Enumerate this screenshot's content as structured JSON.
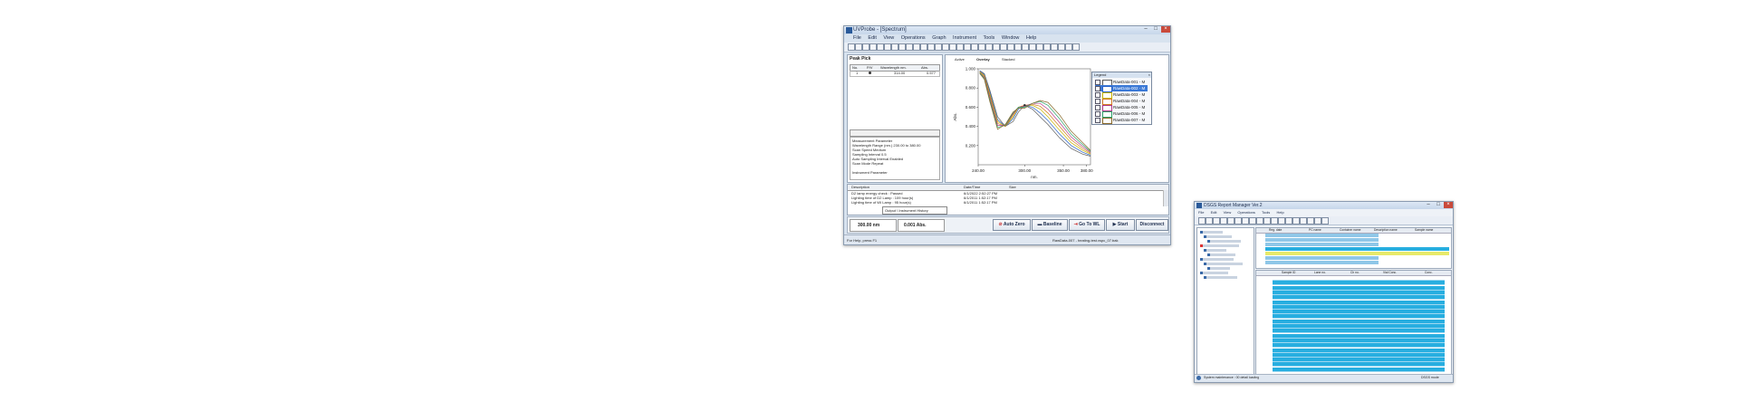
{
  "uvprobe": {
    "title": "UVProbe - [Spectrum]",
    "menu": [
      "File",
      "Edit",
      "View",
      "Operations",
      "Graph",
      "Instrument",
      "Tools",
      "Window",
      "Help"
    ],
    "peak_pick": {
      "title": "Peak Pick",
      "columns": [
        "No.",
        "P/V",
        "Wavelength nm.",
        "Abs."
      ],
      "row": {
        "no": "1",
        "wavelength": "314.00",
        "abs": "0.577"
      }
    },
    "params": [
      "Measurement Parameter",
      "Wavelength Range (nm.)   230.00 to 380.00",
      "Scan Speed        Medium",
      "Sampling Interval  0.5",
      "Auto Sampling Interval     Enabled",
      "Scan Mode          Repeat"
    ],
    "params_extra": "Instrument Parameter",
    "tabs": [
      "Active",
      "Overlay",
      "Stacked"
    ],
    "chart_data": {
      "type": "line",
      "xlabel": "nm.",
      "ylabel": "Abs.",
      "xlim": [
        240,
        385
      ],
      "ylim": [
        0,
        1.0
      ],
      "y_ticks": [
        "1.000",
        "0.800",
        "0.600",
        "0.400",
        "0.200"
      ],
      "x_ticks": [
        "240.00",
        "300.00",
        "350.00",
        "380.00"
      ],
      "series": [
        {
          "name": "RawData-001 - M",
          "color": "#5a5a5a",
          "x": [
            242,
            248,
            255,
            265,
            275,
            285,
            292,
            300,
            310,
            320,
            330,
            345,
            360,
            375,
            385
          ],
          "y": [
            0.98,
            0.95,
            0.78,
            0.5,
            0.4,
            0.45,
            0.55,
            0.62,
            0.58,
            0.5,
            0.42,
            0.28,
            0.17,
            0.11,
            0.09
          ]
        },
        {
          "name": "RawData-002 - M",
          "color": "#2a62c9",
          "x": [
            242,
            248,
            255,
            265,
            275,
            285,
            292,
            300,
            310,
            320,
            330,
            345,
            360,
            375,
            385
          ],
          "y": [
            0.98,
            0.94,
            0.76,
            0.47,
            0.4,
            0.48,
            0.58,
            0.62,
            0.6,
            0.54,
            0.46,
            0.32,
            0.2,
            0.13,
            0.1
          ]
        },
        {
          "name": "RawData-003 - M",
          "color": "#c8b400",
          "x": [
            242,
            248,
            255,
            265,
            275,
            285,
            292,
            300,
            310,
            320,
            330,
            345,
            360,
            375,
            385
          ],
          "y": [
            0.97,
            0.93,
            0.74,
            0.45,
            0.4,
            0.5,
            0.6,
            0.62,
            0.62,
            0.58,
            0.5,
            0.36,
            0.23,
            0.15,
            0.11
          ]
        },
        {
          "name": "RawData-004 - M",
          "color": "#d27a20",
          "x": [
            242,
            248,
            255,
            265,
            275,
            285,
            292,
            300,
            310,
            320,
            330,
            345,
            360,
            375,
            385
          ],
          "y": [
            0.97,
            0.92,
            0.72,
            0.43,
            0.4,
            0.52,
            0.6,
            0.62,
            0.63,
            0.61,
            0.54,
            0.4,
            0.26,
            0.17,
            0.12
          ]
        },
        {
          "name": "RawData-005 - M",
          "color": "#b03a8a",
          "x": [
            242,
            248,
            255,
            265,
            275,
            285,
            292,
            300,
            310,
            320,
            330,
            345,
            360,
            375,
            385
          ],
          "y": [
            0.96,
            0.91,
            0.7,
            0.41,
            0.41,
            0.53,
            0.6,
            0.61,
            0.64,
            0.64,
            0.58,
            0.44,
            0.29,
            0.19,
            0.13
          ]
        },
        {
          "name": "RawData-006 - M",
          "color": "#2fa36b",
          "x": [
            242,
            248,
            255,
            265,
            275,
            285,
            292,
            300,
            310,
            320,
            330,
            345,
            360,
            375,
            385
          ],
          "y": [
            0.96,
            0.9,
            0.68,
            0.39,
            0.41,
            0.54,
            0.6,
            0.6,
            0.64,
            0.66,
            0.62,
            0.48,
            0.32,
            0.21,
            0.14
          ]
        },
        {
          "name": "RawData-007 - M",
          "color": "#8a6a2a",
          "x": [
            242,
            248,
            255,
            265,
            275,
            285,
            292,
            300,
            310,
            320,
            330,
            345,
            360,
            375,
            385
          ],
          "y": [
            0.95,
            0.89,
            0.66,
            0.37,
            0.42,
            0.55,
            0.59,
            0.59,
            0.64,
            0.67,
            0.65,
            0.52,
            0.35,
            0.23,
            0.15
          ]
        }
      ]
    },
    "legend_title": "Legend",
    "history": {
      "columns": [
        "Description",
        "Date/Time",
        "Size"
      ],
      "rows": [
        {
          "desc": "D2 lamp energy check : Passed",
          "date": "6/1/2022 2:52:27 PM"
        },
        {
          "desc": "Lighting time of D2 Lamp : 109 hour(s)",
          "date": "6/1/2011 1:52:17 PM"
        },
        {
          "desc": "Lighting time of WI Lamp : 95 hour(s)",
          "date": "6/1/2011 1:52:17 PM"
        }
      ],
      "tab_label": "Output \\ Instrument History"
    },
    "status_wavelength": "300.00 nm",
    "status_abs": "0.001 Abs.",
    "buttons": {
      "auto_zero": "Auto Zero",
      "baseline": "Baseline",
      "goto_wl": "Go To WL",
      "start": "Start",
      "disconnect": "Disconnect"
    },
    "statusbar_left": "For Help, press F1",
    "statusbar_right": "RawData-007 - heating-test.vspc_07.bak"
  },
  "manager": {
    "title": "DSGS Report Manager Ver.2",
    "menu": [
      "File",
      "Edit",
      "View",
      "Operations",
      "Tools",
      "Help"
    ],
    "top_columns": [
      "Reg. date",
      "PC name",
      "Container name",
      "Description name",
      "Sample name"
    ],
    "bottom_columns": [
      "Sample ID",
      "Lane no.",
      "Ch no.",
      "Vial Conc.",
      "Conc."
    ],
    "statusbar_left": "System maintenance : 00 detail loading",
    "statusbar_right": "DSGS mode"
  }
}
